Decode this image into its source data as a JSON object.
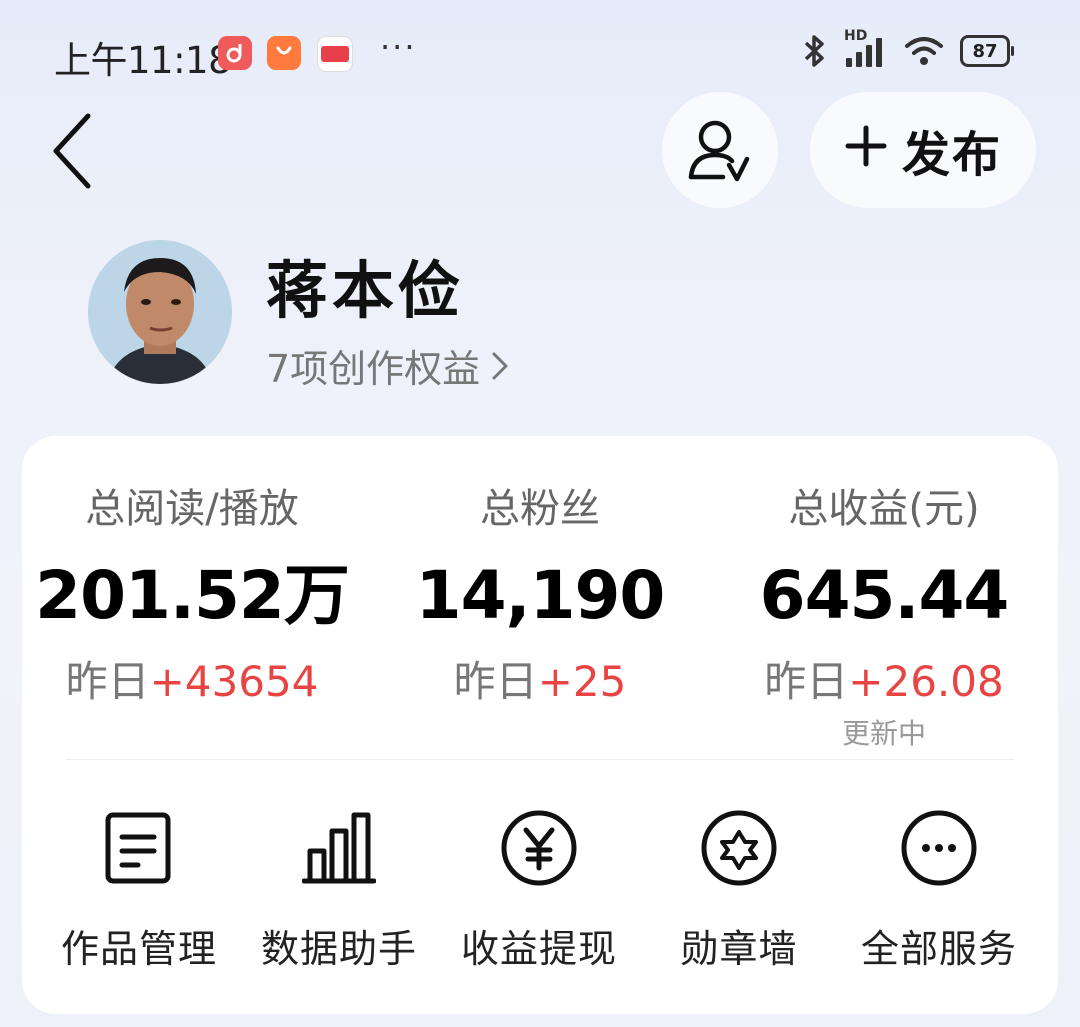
{
  "status_bar": {
    "time": "上午11:18",
    "battery": "87",
    "network_label": "HD"
  },
  "header": {
    "publish_label": "发布"
  },
  "profile": {
    "name": "蒋本俭",
    "benefits_label": "7项创作权益"
  },
  "stats": [
    {
      "label": "总阅读/播放",
      "value": "201.52万",
      "delta_prefix": "昨日",
      "delta": "+43654"
    },
    {
      "label": "总粉丝",
      "value": "14,190",
      "delta_prefix": "昨日",
      "delta": "+25"
    },
    {
      "label": "总收益(元)",
      "value": "645.44",
      "delta_prefix": "昨日",
      "delta": "+26.08"
    }
  ],
  "earnings_status": "更新中",
  "services": [
    {
      "label": "作品管理",
      "icon": "document-icon"
    },
    {
      "label": "数据助手",
      "icon": "bar-chart-icon"
    },
    {
      "label": "收益提现",
      "icon": "yen-icon"
    },
    {
      "label": "勋章墙",
      "icon": "badge-icon"
    },
    {
      "label": "全部服务",
      "icon": "more-icon"
    }
  ],
  "colors": {
    "accent_red": "#e84444",
    "text_primary": "#111111",
    "text_secondary": "#777777"
  }
}
